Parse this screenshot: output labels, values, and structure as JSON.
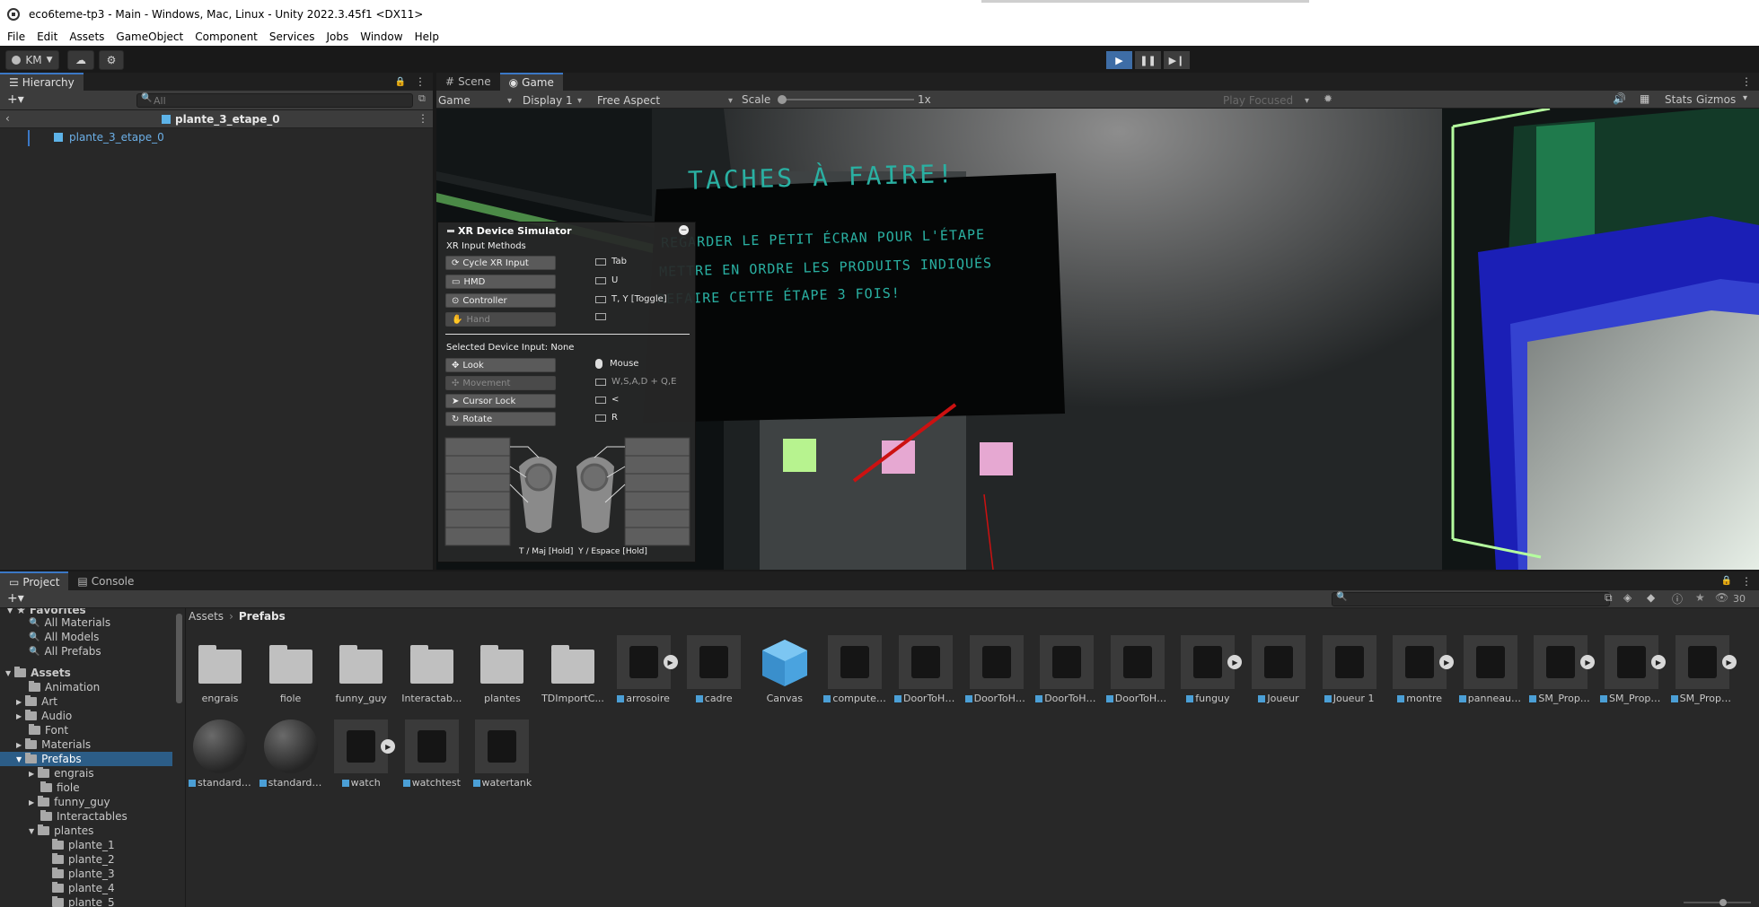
{
  "window": {
    "title": "eco6teme-tp3 - Main - Windows, Mac, Linux - Unity 2022.3.45f1 <DX11>"
  },
  "menu": [
    "File",
    "Edit",
    "Assets",
    "GameObject",
    "Component",
    "Services",
    "Jobs",
    "Window",
    "Help"
  ],
  "toolbar": {
    "account": "KM"
  },
  "hierarchy": {
    "tab": "Hierarchy",
    "search_placeholder": "All",
    "breadcrumb": "plante_3_etape_0",
    "items": [
      "plante_3_etape_0"
    ]
  },
  "views": {
    "tabs": [
      "Scene",
      "Game"
    ]
  },
  "game_toolbar": {
    "mode": "Game",
    "display": "Display 1",
    "aspect": "Free Aspect",
    "scale_label": "Scale",
    "scale_value": "1x",
    "play_mode": "Play Focused",
    "stats": "Stats",
    "gizmos": "Gizmos"
  },
  "scene_board": {
    "title": "TACHES À FAIRE!",
    "lines": [
      "REGARDER LE PETIT ÉCRAN POUR L'ÉTAPE",
      "METTRE EN ORDRE LES PRODUITS INDIQUÉS",
      "REFAIRE CETTE ÉTAPE 3 FOIS!"
    ]
  },
  "xr_simulator": {
    "title": "XR Device Simulator",
    "section": "XR Input Methods",
    "methods": [
      {
        "label": "Cycle XR Input",
        "key": "Tab"
      },
      {
        "label": "HMD",
        "key": "U"
      },
      {
        "label": "Controller",
        "key": "T, Y [Toggle]"
      },
      {
        "label": "Hand",
        "key": ""
      }
    ],
    "selected": "Selected Device Input:  None",
    "inputs": [
      {
        "label": "Look",
        "key": "Mouse"
      },
      {
        "label": "Movement",
        "key": "W,S,A,D + Q,E"
      },
      {
        "label": "Cursor Lock",
        "key": "<"
      },
      {
        "label": "Rotate",
        "key": "R"
      }
    ],
    "footer": "T / Maj [Hold]  Y / Espace [Hold]"
  },
  "project": {
    "tabs": [
      "Project",
      "Console"
    ],
    "count": "30",
    "favorites_label": "Favorites",
    "favorites": [
      "All Materials",
      "All Models",
      "All Prefabs"
    ],
    "tree": [
      {
        "label": "Assets",
        "indent": 0,
        "open": true
      },
      {
        "label": "Animation",
        "indent": 1
      },
      {
        "label": "Art",
        "indent": 1,
        "arrow": true
      },
      {
        "label": "Audio",
        "indent": 1,
        "arrow": true
      },
      {
        "label": "Font",
        "indent": 1
      },
      {
        "label": "Materials",
        "indent": 1,
        "arrow": true
      },
      {
        "label": "Prefabs",
        "indent": 1,
        "open": true,
        "selected": true
      },
      {
        "label": "engrais",
        "indent": 2,
        "arrow": true
      },
      {
        "label": "fiole",
        "indent": 2
      },
      {
        "label": "funny_guy",
        "indent": 2,
        "arrow": true
      },
      {
        "label": "Interactables",
        "indent": 2
      },
      {
        "label": "plantes",
        "indent": 2,
        "open": true
      },
      {
        "label": "plante_1",
        "indent": 3
      },
      {
        "label": "plante_2",
        "indent": 3
      },
      {
        "label": "plante_3",
        "indent": 3
      },
      {
        "label": "plante_4",
        "indent": 3
      },
      {
        "label": "plante_5",
        "indent": 3
      }
    ],
    "breadcrumb": [
      "Assets",
      "Prefabs"
    ],
    "assets_row1": [
      {
        "label": "engrais",
        "kind": "folder"
      },
      {
        "label": "fiole",
        "kind": "folder"
      },
      {
        "label": "funny_guy",
        "kind": "folder"
      },
      {
        "label": "Interactab...",
        "kind": "folder"
      },
      {
        "label": "plantes",
        "kind": "folder"
      },
      {
        "label": "TDImportC...",
        "kind": "folder"
      },
      {
        "label": "arrosoire",
        "kind": "prefab",
        "arrow": true
      },
      {
        "label": "cadre",
        "kind": "prefab"
      },
      {
        "label": "Canvas",
        "kind": "canvas"
      },
      {
        "label": "computer_...",
        "kind": "prefab"
      },
      {
        "label": "DoorToHal...",
        "kind": "prefab"
      },
      {
        "label": "DoorToHal...",
        "kind": "prefab"
      },
      {
        "label": "DoorToHal...",
        "kind": "prefab"
      },
      {
        "label": "DoorToHal...",
        "kind": "prefab"
      },
      {
        "label": "funguy",
        "kind": "prefab",
        "arrow": true
      },
      {
        "label": "Joueur",
        "kind": "prefab"
      },
      {
        "label": "Joueur 1",
        "kind": "prefab"
      },
      {
        "label": "montre",
        "kind": "prefab",
        "arrow": true
      },
      {
        "label": "panneau_...",
        "kind": "prefab"
      },
      {
        "label": "SM_Prop_...",
        "kind": "prefab",
        "arrow": true
      },
      {
        "label": "SM_Prop_...",
        "kind": "prefab",
        "arrow": true
      },
      {
        "label": "SM_Prop_...",
        "kind": "prefab",
        "arrow": true
      }
    ],
    "assets_row2": [
      {
        "label": "standardS...",
        "kind": "sphere"
      },
      {
        "label": "standardS...",
        "kind": "sphere"
      },
      {
        "label": "watch",
        "kind": "prefab",
        "arrow": true
      },
      {
        "label": "watchtest",
        "kind": "prefab"
      },
      {
        "label": "watertank",
        "kind": "prefab"
      }
    ]
  },
  "colors": {
    "accent": "#3b78c6",
    "play_active": "#3e6da6",
    "board_text": "#2ab0a2",
    "selection": "#2c5d87"
  }
}
